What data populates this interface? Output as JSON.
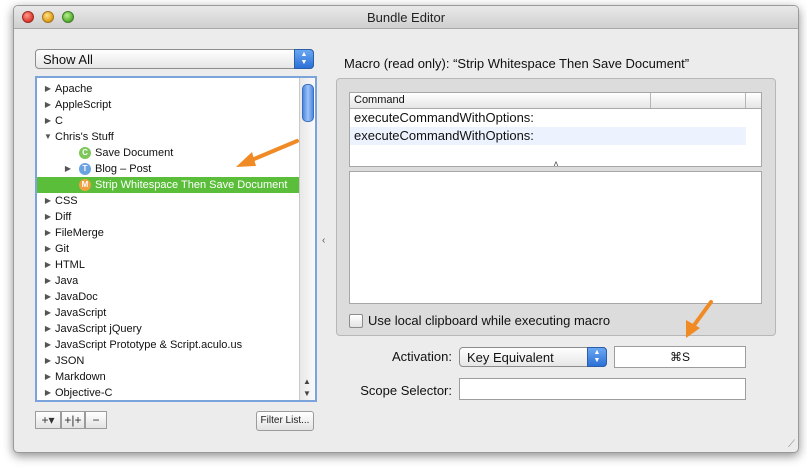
{
  "window": {
    "title": "Bundle Editor"
  },
  "filter_popup": {
    "value": "Show All"
  },
  "tree": {
    "items": [
      {
        "label": "Apache",
        "disclosure": "▶",
        "badge": ""
      },
      {
        "label": "AppleScript",
        "disclosure": "▶",
        "badge": ""
      },
      {
        "label": "C",
        "disclosure": "▶",
        "badge": ""
      },
      {
        "label": "Chris's Stuff",
        "disclosure": "▼",
        "badge": ""
      },
      {
        "label": "Save Document",
        "disclosure": "",
        "badge": "C"
      },
      {
        "label": "Blog – Post",
        "disclosure": "▶",
        "badge": "T"
      },
      {
        "label": "Strip Whitespace Then Save Document",
        "disclosure": "",
        "badge": "M"
      },
      {
        "label": "CSS",
        "disclosure": "▶",
        "badge": ""
      },
      {
        "label": "Diff",
        "disclosure": "▶",
        "badge": ""
      },
      {
        "label": "FileMerge",
        "disclosure": "▶",
        "badge": ""
      },
      {
        "label": "Git",
        "disclosure": "▶",
        "badge": ""
      },
      {
        "label": "HTML",
        "disclosure": "▶",
        "badge": ""
      },
      {
        "label": "Java",
        "disclosure": "▶",
        "badge": ""
      },
      {
        "label": "JavaDoc",
        "disclosure": "▶",
        "badge": ""
      },
      {
        "label": "JavaScript",
        "disclosure": "▶",
        "badge": ""
      },
      {
        "label": "JavaScript jQuery",
        "disclosure": "▶",
        "badge": ""
      },
      {
        "label": "JavaScript Prototype & Script.aculo.us",
        "disclosure": "▶",
        "badge": ""
      },
      {
        "label": "JSON",
        "disclosure": "▶",
        "badge": ""
      },
      {
        "label": "Markdown",
        "disclosure": "▶",
        "badge": ""
      },
      {
        "label": "Objective-C",
        "disclosure": "▶",
        "badge": ""
      }
    ],
    "selected_label": "Strip Whitespace Then Save Document"
  },
  "bottom_toolbar": {
    "add_label": "+▾",
    "add_child_label": "+|+",
    "remove_label": "−",
    "filter_list_label": "Filter List..."
  },
  "macro": {
    "title": "Macro (read only): “Strip Whitespace Then Save Document”",
    "table_header": "Command",
    "rows": [
      "executeCommandWithOptions:",
      "executeCommandWithOptions:"
    ],
    "clipboard_label": "Use local clipboard while executing macro"
  },
  "activation": {
    "label": "Activation:",
    "value": "Key Equivalent",
    "key": "⌘S"
  },
  "scope": {
    "label": "Scope Selector:",
    "value": ""
  },
  "colors": {
    "selection": "#5bbe3b",
    "accent": "#2c6fd6",
    "annotation_arrow": "#f08a24"
  }
}
